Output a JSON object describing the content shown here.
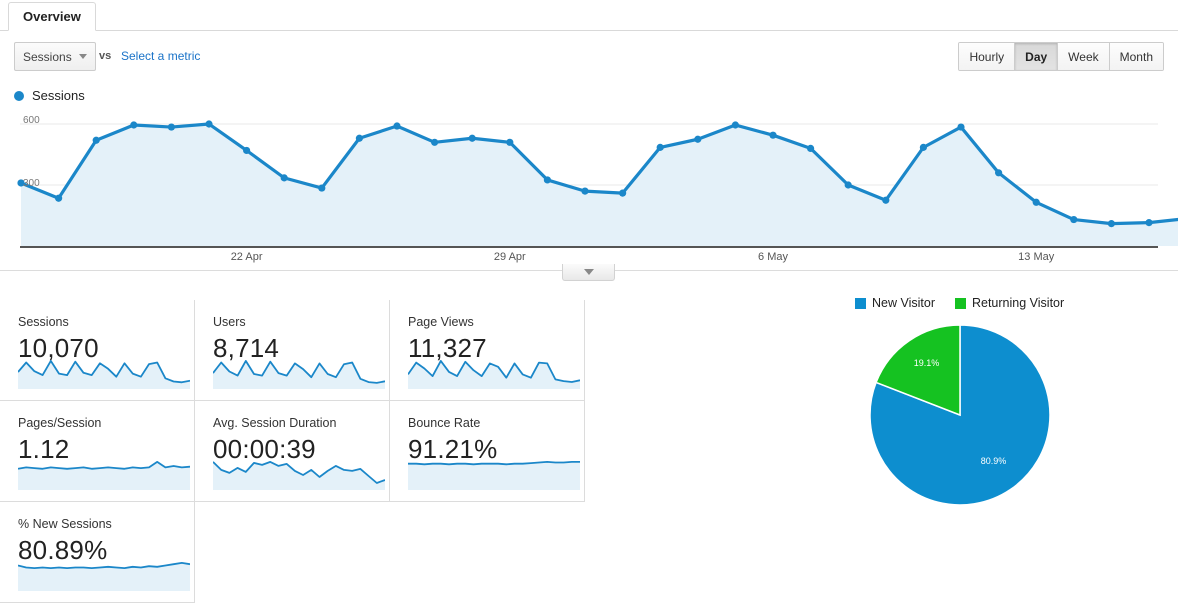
{
  "tab": {
    "label": "Overview"
  },
  "metric_selector": {
    "selected": "Sessions",
    "vs_label": "vs",
    "compare_link": "Select a metric",
    "caret_icon": "chevron-down-icon"
  },
  "granularity": {
    "options": [
      "Hourly",
      "Day",
      "Week",
      "Month"
    ],
    "selected": "Day"
  },
  "series_legend": {
    "name": "Sessions",
    "color": "#1b87c9"
  },
  "chart_controls": {
    "collapse_icon": "chevron-down-icon"
  },
  "colors": {
    "line": "#1b87c9",
    "area": "#e4f1f9",
    "new_visitor": "#0d8ecf",
    "returning_visitor": "#15c221",
    "link": "#1a73c8"
  },
  "chart_data": {
    "type": "area",
    "title": "Sessions",
    "xlabel": "",
    "ylabel": "Sessions",
    "ylim": [
      0,
      700
    ],
    "yticks": [
      300,
      600
    ],
    "ytick_labels": [
      "300",
      "600"
    ],
    "grid": true,
    "legend": "top-left",
    "xtick_labels": [
      "22 Apr",
      "29 Apr",
      "6 May",
      "13 May"
    ],
    "xtick_indices": [
      6,
      13,
      20,
      27
    ],
    "series": [
      {
        "name": "Sessions",
        "values": [
          310,
          235,
          520,
          595,
          585,
          600,
          470,
          335,
          285,
          530,
          590,
          510,
          530,
          510,
          325,
          270,
          260,
          485,
          525,
          595,
          545,
          480,
          300,
          225,
          485,
          585,
          360,
          215,
          130,
          110,
          115,
          135
        ]
      }
    ]
  },
  "metric_cards": [
    {
      "title": "Sessions",
      "value": "10,070",
      "sparkline": [
        38,
        62,
        40,
        30,
        66,
        34,
        30,
        64,
        36,
        30,
        60,
        46,
        26,
        60,
        34,
        26,
        58,
        62,
        22,
        14,
        12,
        16
      ]
    },
    {
      "title": "Users",
      "value": "8,714",
      "sparkline": [
        34,
        60,
        38,
        28,
        64,
        32,
        28,
        62,
        34,
        28,
        58,
        44,
        24,
        58,
        32,
        24,
        56,
        60,
        20,
        12,
        10,
        14
      ]
    },
    {
      "title": "Page Views",
      "value": "11,327",
      "sparkline": [
        30,
        58,
        44,
        26,
        62,
        36,
        26,
        60,
        40,
        26,
        56,
        48,
        22,
        56,
        30,
        22,
        58,
        56,
        18,
        14,
        12,
        16
      ]
    },
    {
      "title": "Pages/Session",
      "value": "1.12",
      "sparkline": [
        28,
        30,
        29,
        28,
        30,
        29,
        28,
        29,
        30,
        28,
        29,
        30,
        29,
        28,
        30,
        29,
        30,
        38,
        30,
        32,
        30,
        31
      ]
    },
    {
      "title": "Avg. Session Duration",
      "value": "00:00:39",
      "sparkline": [
        52,
        36,
        30,
        40,
        32,
        50,
        46,
        52,
        44,
        48,
        34,
        26,
        36,
        22,
        34,
        44,
        36,
        34,
        38,
        24,
        10,
        16
      ]
    },
    {
      "title": "Bounce Rate",
      "value": "91.21%",
      "sparkline": [
        40,
        40,
        39,
        40,
        40,
        39,
        40,
        40,
        39,
        40,
        40,
        40,
        39,
        40,
        40,
        41,
        42,
        43,
        42,
        42,
        43,
        43
      ]
    },
    {
      "title": "% New Sessions",
      "value": "80.89%",
      "sparkline": [
        36,
        33,
        32,
        33,
        32,
        33,
        32,
        33,
        33,
        32,
        33,
        34,
        33,
        32,
        34,
        33,
        35,
        34,
        36,
        38,
        40,
        38
      ]
    }
  ],
  "pie_chart": {
    "type": "pie",
    "title": "",
    "legend": [
      "New Visitor",
      "Returning Visitor"
    ],
    "slices": [
      {
        "label": "New Visitor",
        "percent": 80.9,
        "display": "80.9%",
        "color": "#0d8ecf"
      },
      {
        "label": "Returning Visitor",
        "percent": 19.1,
        "display": "19.1%",
        "color": "#15c221"
      }
    ]
  }
}
